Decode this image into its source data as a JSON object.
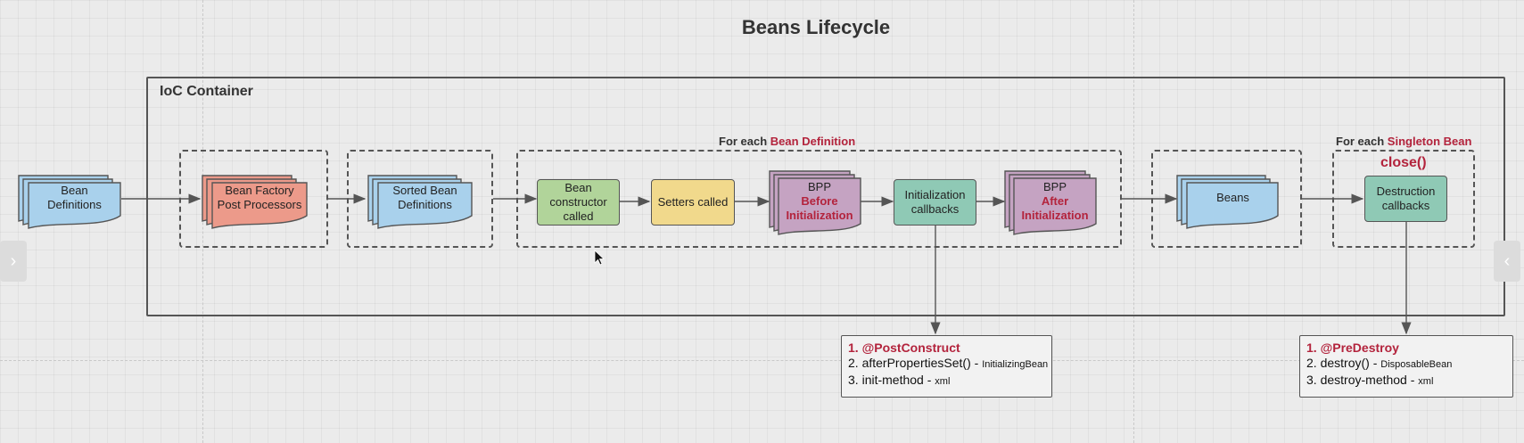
{
  "title": "Beans Lifecycle",
  "container": {
    "label": "IoC Container"
  },
  "groups": {
    "bean_definition": {
      "prefix": "For each ",
      "highlight": "Bean Definition"
    },
    "singleton": {
      "prefix": "For each ",
      "highlight": "Singleton Bean"
    }
  },
  "nodes": {
    "bean_definitions": {
      "line1": "Bean",
      "line2": "Definitions"
    },
    "bfpp": {
      "line1": "Bean Factory",
      "line2": "Post Processors"
    },
    "sorted": {
      "line1": "Sorted Bean",
      "line2": "Definitions"
    },
    "constructor": {
      "line1": "Bean",
      "line2": "constructor",
      "line3": "called"
    },
    "setters": {
      "label": "Setters called"
    },
    "bpp_before": {
      "line1": "BPP",
      "line2": "Before",
      "line3": "Initialization"
    },
    "init_callbacks": {
      "line1": "Initialization",
      "line2": "callbacks"
    },
    "bpp_after": {
      "line1": "BPP",
      "line2": "After",
      "line3": "Initialization"
    },
    "beans": {
      "label": "Beans"
    },
    "destruction": {
      "line1": "Destruction",
      "line2": "callbacks"
    },
    "close": {
      "label": "close()"
    }
  },
  "init_note": {
    "items": [
      {
        "num": "1.",
        "main": "@PostConstruct",
        "suffix": ""
      },
      {
        "num": "2.",
        "main": "afterPropertiesSet() - ",
        "suffix": "InitializingBean"
      },
      {
        "num": "3.",
        "main": "init-method - ",
        "suffix": "xml"
      }
    ]
  },
  "destroy_note": {
    "items": [
      {
        "num": "1.",
        "main": "@PreDestroy",
        "suffix": ""
      },
      {
        "num": "2.",
        "main": "destroy() - ",
        "suffix": "DisposableBean"
      },
      {
        "num": "3.",
        "main": "destroy-method - ",
        "suffix": "xml"
      }
    ]
  },
  "colors": {
    "blue_doc": "#a9d1ec",
    "red_doc": "#ec9a8a",
    "purple_doc": "#c5a3c2",
    "green_box": "#b1d49a",
    "yellow_box": "#f1d98c",
    "teal_box": "#8fc9b5",
    "accent_red": "#b3233c"
  },
  "icons": {
    "left_tab": "chevron-right-icon",
    "right_tab": "chevron-left-icon",
    "cursor": "mouse-pointer-icon"
  }
}
